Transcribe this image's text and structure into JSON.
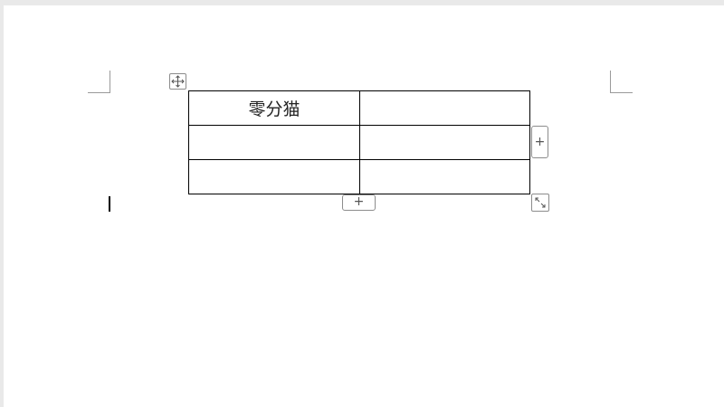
{
  "document": {
    "table": {
      "rows": [
        [
          "零分猫",
          ""
        ],
        [
          "",
          ""
        ],
        [
          "",
          ""
        ]
      ]
    },
    "controls": {
      "add_column_label": "+",
      "add_row_label": "+"
    },
    "icons": {
      "move": "move-arrows-icon",
      "resize": "diagonal-resize-icon"
    },
    "colors": {
      "border": "#000000",
      "handle_border": "#8c8c8c",
      "page_background": "#ffffff"
    }
  }
}
